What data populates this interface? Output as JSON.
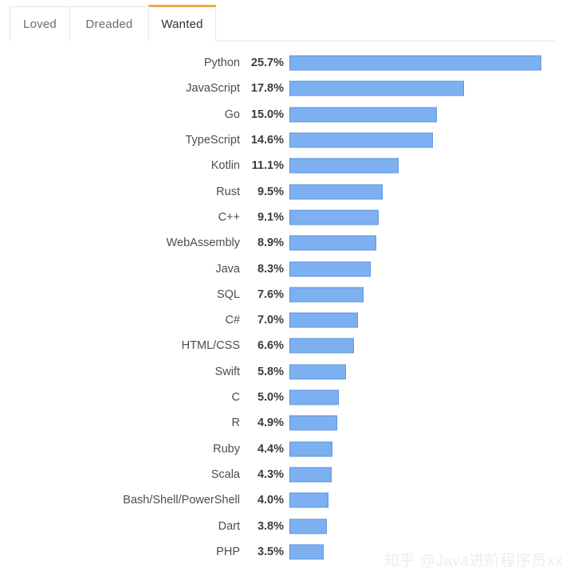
{
  "tabs": [
    {
      "label": "Loved",
      "active": false
    },
    {
      "label": "Dreaded",
      "active": false
    },
    {
      "label": "Wanted",
      "active": true
    }
  ],
  "watermark": "知乎 @Java进阶程序员xx",
  "colors": {
    "bar_fill": "#7cb0f0",
    "bar_border": "#5a94e0",
    "active_tab_accent": "#eda942",
    "tab_border": "#e6e6e6",
    "label_text": "#4d4d4d",
    "value_text": "#3c3c3c",
    "watermark_text": "#ededed"
  },
  "chart_data": {
    "type": "bar",
    "orientation": "horizontal",
    "title": "",
    "subtitle": "",
    "xlabel": "",
    "ylabel": "",
    "grid": false,
    "legend": false,
    "xlim": [
      0,
      27
    ],
    "value_suffix": "%",
    "categories": [
      "Python",
      "JavaScript",
      "Go",
      "TypeScript",
      "Kotlin",
      "Rust",
      "C++",
      "WebAssembly",
      "Java",
      "SQL",
      "C#",
      "HTML/CSS",
      "Swift",
      "C",
      "R",
      "Ruby",
      "Scala",
      "Bash/Shell/PowerShell",
      "Dart",
      "PHP"
    ],
    "values": [
      25.7,
      17.8,
      15.0,
      14.6,
      11.1,
      9.5,
      9.1,
      8.9,
      8.3,
      7.6,
      7.0,
      6.6,
      5.8,
      5.0,
      4.9,
      4.4,
      4.3,
      4.0,
      3.8,
      3.5
    ],
    "value_labels": [
      "25.7%",
      "17.8%",
      "15.0%",
      "14.6%",
      "11.1%",
      "9.5%",
      "9.1%",
      "8.9%",
      "8.3%",
      "7.6%",
      "7.0%",
      "6.6%",
      "5.8%",
      "5.0%",
      "4.9%",
      "4.4%",
      "4.3%",
      "4.0%",
      "3.8%",
      "3.5%"
    ]
  }
}
